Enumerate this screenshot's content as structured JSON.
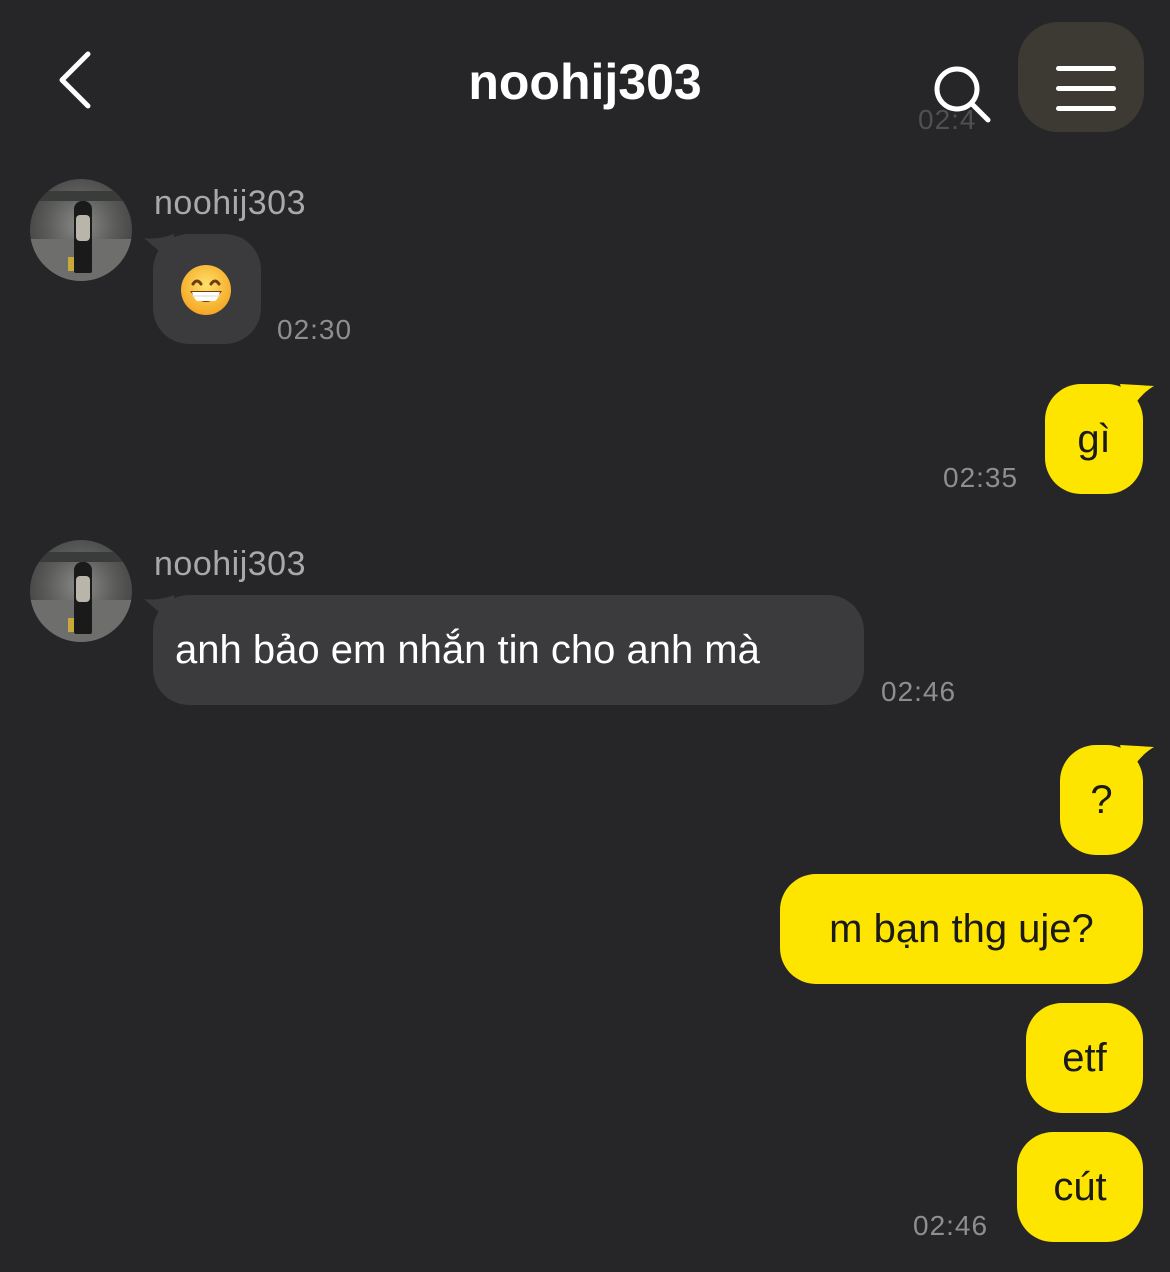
{
  "header": {
    "title": "noohij303",
    "ghost_time": "02:4"
  },
  "messages": [
    {
      "direction": "in",
      "sender": "noohij303",
      "content_type": "emoji",
      "emoji": "grinning-face-with-smiling-eyes",
      "time": "02:30"
    },
    {
      "direction": "out",
      "text": "gì",
      "time": "02:35"
    },
    {
      "direction": "in",
      "sender": "noohij303",
      "text": "anh bảo em nhắn tin cho anh mà",
      "time": "02:46"
    },
    {
      "direction": "out",
      "text": "?"
    },
    {
      "direction": "out",
      "text": "m bạn thg uje?"
    },
    {
      "direction": "out",
      "text": "etf"
    },
    {
      "direction": "out",
      "text": "cút",
      "time": "02:46"
    }
  ],
  "colors": {
    "background": "#262628",
    "incoming_bubble": "#3b3b3d",
    "outgoing_bubble": "#fee500",
    "timestamp": "#8e8e8e",
    "sender_name": "#a9a9a9"
  },
  "icons": [
    "back-chevron-icon",
    "search-icon",
    "menu-icon"
  ]
}
